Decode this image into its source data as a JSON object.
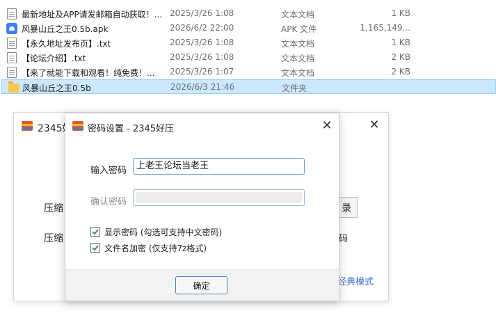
{
  "files": [
    {
      "name": "最新地址及APP请发邮箱自动获取！...",
      "date": "2025/3/26 1:08",
      "type": "文本文档",
      "size": "1 KB",
      "icon": "text-document-icon"
    },
    {
      "name": "风暴山丘之王0.5b.apk",
      "date": "2026/6/2 22:00",
      "type": "APK 文件",
      "size": "1,165,149...",
      "icon": "apk-file-icon"
    },
    {
      "name": "【永久地址发布页】.txt",
      "date": "2025/3/26 1:08",
      "type": "文本文档",
      "size": "1 KB",
      "icon": "text-document-icon"
    },
    {
      "name": "【论坛介绍】.txt",
      "date": "2025/3/26 1:08",
      "type": "文本文档",
      "size": "2 KB",
      "icon": "text-document-icon"
    },
    {
      "name": "【来了就能下载和观看！纯免费！...",
      "date": "2025/3/26 1:07",
      "type": "文本文档",
      "size": "2 KB",
      "icon": "text-document-icon"
    },
    {
      "name": "风暴山丘之王0.5b",
      "date": "2026/6/3 21:46",
      "type": "文件夹",
      "size": "",
      "icon": "folder-icon",
      "selected": true
    }
  ],
  "back_window": {
    "title": "2345好",
    "label_1": "压缩",
    "label_2": "压缩",
    "button_fragment": "录",
    "right_text": "码",
    "link": "经典模式",
    "close": "✕"
  },
  "dialog": {
    "title": "密码设置 - 2345好压",
    "close": "✕",
    "password_label": "输入密码",
    "password_value": "上老王论坛当老王",
    "confirm_label": "确认密码",
    "confirm_value": "",
    "show_password_label": "显示密码 (勾选可支持中文密码)",
    "show_password_checked": true,
    "encrypt_filename_label": "文件名加密  (仅支持7z格式)",
    "encrypt_filename_checked": true,
    "ok_label": "确定"
  },
  "colors": {
    "selection": "#cce8ff",
    "accent": "#4a7fc1",
    "link": "#3a6fc9",
    "checkmark": "#2f8a3a"
  }
}
